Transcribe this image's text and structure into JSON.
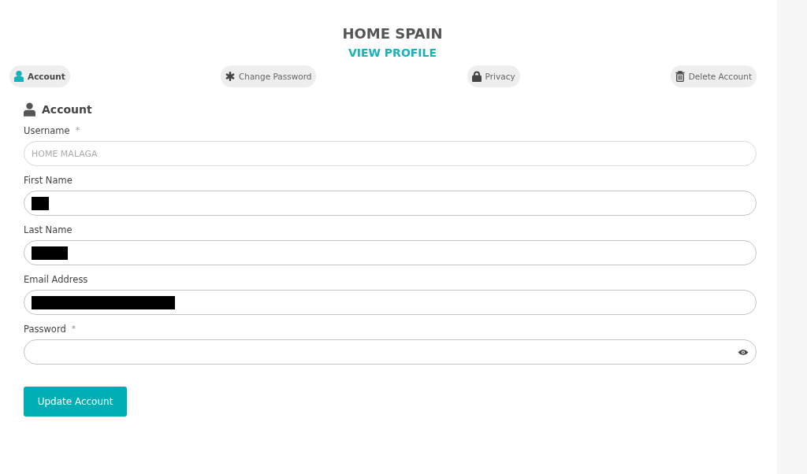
{
  "profile": {
    "title": "HOME SPAIN",
    "link": "VIEW PROFILE"
  },
  "tabs": [
    {
      "label": "Account",
      "kind": "user",
      "selected": true
    },
    {
      "label": "Change Password",
      "kind": "asterisk",
      "selected": false
    },
    {
      "label": "Privacy",
      "kind": "lock",
      "selected": false
    },
    {
      "label": "Delete Account",
      "kind": "trash",
      "selected": false
    }
  ],
  "section": {
    "title": "Account"
  },
  "fields": [
    {
      "label": "Username",
      "required_mark": "*",
      "value": "HOME MALAGA",
      "disabled": true,
      "kind": "text"
    },
    {
      "label": "First Name",
      "disabled": false,
      "kind": "redacted"
    },
    {
      "label": "Last Name",
      "disabled": false,
      "kind": "redacted"
    },
    {
      "label": "Email Address",
      "disabled": false,
      "kind": "redacted"
    },
    {
      "label": "Password",
      "required_mark": "*",
      "disabled": false,
      "kind": "password"
    }
  ],
  "button": "Update Account"
}
